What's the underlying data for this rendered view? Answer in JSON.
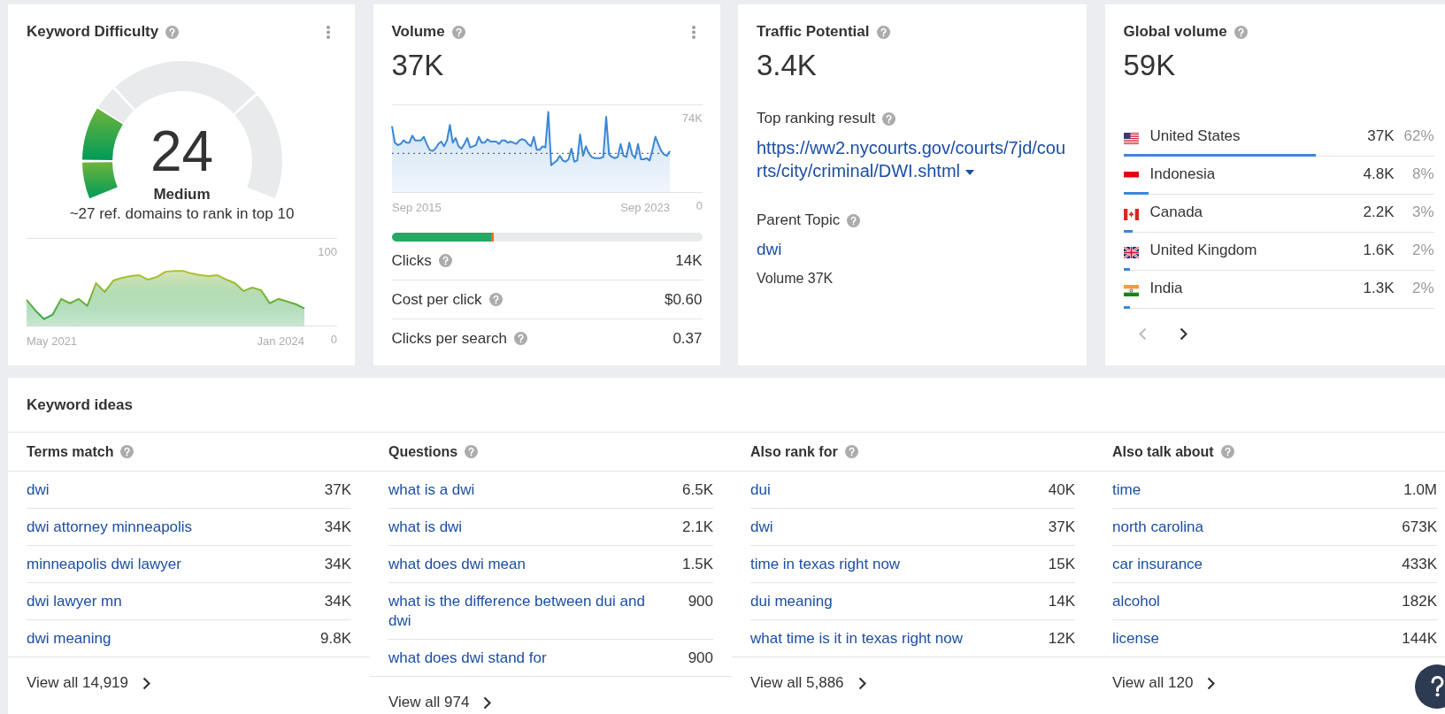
{
  "keyword_difficulty": {
    "title": "Keyword Difficulty",
    "score": "24",
    "level": 0.24,
    "rating": "Medium",
    "note": "~27 ref. domains to rank in top 10",
    "period_start": "May 2021",
    "period_end": "Jan 2024",
    "chart_data": {
      "type": "area",
      "series": [
        {
          "color": "#22a04b",
          "values": [
            30,
            18,
            8,
            13,
            31,
            26,
            31,
            23,
            49,
            39,
            52,
            55,
            57,
            58,
            53,
            56,
            62,
            63,
            63,
            60,
            58,
            57,
            58,
            53,
            49,
            40,
            44,
            41,
            26,
            31,
            28,
            25,
            20
          ]
        }
      ],
      "yticks": [
        0,
        100
      ],
      "ylim": [
        0,
        100
      ]
    }
  },
  "volume": {
    "title": "Volume",
    "value": "37K",
    "period_start": "Sep 2015",
    "period_end": "Sep 2023",
    "chart_data": {
      "type": "area",
      "series": [
        {
          "color": "#3a87d6",
          "values": [
            56,
            42,
            40,
            41,
            44,
            42,
            42,
            48,
            44,
            44,
            44,
            47,
            41,
            36,
            35,
            37,
            41,
            43,
            39,
            44,
            57,
            42,
            46,
            39,
            37,
            41,
            46,
            38,
            39,
            40,
            47,
            42,
            42,
            45,
            43,
            43,
            43,
            41,
            44,
            44,
            42,
            43,
            42,
            41,
            44,
            45,
            44,
            41,
            39,
            47,
            36,
            36,
            39,
            38,
            68,
            23,
            25,
            27,
            31,
            27,
            26,
            28,
            37,
            26,
            27,
            49,
            31,
            39,
            33,
            30,
            29,
            29,
            29,
            30,
            64,
            32,
            30,
            29,
            30,
            41,
            31,
            30,
            42,
            32,
            29,
            41,
            28,
            28,
            29,
            27,
            36,
            47,
            41,
            35,
            32,
            31,
            35
          ]
        }
      ],
      "yticks": [
        0,
        {
          "value": 74,
          "label": "74K"
        }
      ],
      "ylim": [
        0,
        74
      ],
      "ref_lines": [
        {
          "axis": "y",
          "value": 33
        }
      ]
    },
    "clicks_bar": {
      "segments": [
        {
          "color": "#27a864",
          "level": 0.32
        },
        {
          "color": "#f26b1d",
          "level": 0.01
        }
      ]
    },
    "metrics": [
      {
        "label": "Clicks",
        "value": "14K"
      },
      {
        "label": "Cost per click",
        "value": "$0.60"
      },
      {
        "label": "Clicks per search",
        "value": "0.37"
      }
    ]
  },
  "traffic_potential": {
    "title": "Traffic Potential",
    "value": "3.4K",
    "top_result": {
      "label": "Top ranking result",
      "url": "https://ww2.nycourts.gov/courts/7jd/courts/city/criminal/DWI.shtml"
    },
    "parent_topic": {
      "label": "Parent Topic",
      "keyword": "dwi",
      "volume": "Volume 37K"
    }
  },
  "global_volume": {
    "title": "Global volume",
    "value": "59K",
    "countries": [
      {
        "kind": "us",
        "name": "United States",
        "volume": "37K",
        "share": "62%",
        "level": 0.62
      },
      {
        "kind": "id",
        "name": "Indonesia",
        "volume": "4.8K",
        "share": "8%",
        "level": 0.08
      },
      {
        "kind": "ca",
        "name": "Canada",
        "volume": "2.2K",
        "share": "3%",
        "level": 0.03
      },
      {
        "kind": "gb",
        "name": "United Kingdom",
        "volume": "1.6K",
        "share": "2%",
        "level": 0.02
      },
      {
        "kind": "in",
        "name": "India",
        "volume": "1.3K",
        "share": "2%",
        "level": 0.02
      }
    ],
    "pager": [
      {
        "kind": "prev",
        "disabled": true
      },
      {
        "kind": "next",
        "disabled": false
      }
    ]
  },
  "keyword_ideas": {
    "title": "Keyword ideas",
    "columns": [
      {
        "title": "Terms match",
        "rows": [
          {
            "keyword": "dwi",
            "volume": "37K"
          },
          {
            "keyword": "dwi attorney minneapolis",
            "volume": "34K"
          },
          {
            "keyword": "minneapolis dwi lawyer",
            "volume": "34K"
          },
          {
            "keyword": "dwi lawyer mn",
            "volume": "34K"
          },
          {
            "keyword": "dwi meaning",
            "volume": "9.8K"
          }
        ],
        "view_all": "View all 14,919"
      },
      {
        "title": "Questions",
        "rows": [
          {
            "keyword": "what is a dwi",
            "volume": "6.5K"
          },
          {
            "keyword": "what is dwi",
            "volume": "2.1K"
          },
          {
            "keyword": "what does dwi mean",
            "volume": "1.5K"
          },
          {
            "keyword": "what is the difference between dui and dwi",
            "volume": "900"
          },
          {
            "keyword": "what does dwi stand for",
            "volume": "900"
          }
        ],
        "view_all": "View all 974"
      },
      {
        "title": "Also rank for",
        "rows": [
          {
            "keyword": "dui",
            "volume": "40K"
          },
          {
            "keyword": "dwi",
            "volume": "37K"
          },
          {
            "keyword": "time in texas right now",
            "volume": "15K"
          },
          {
            "keyword": "dui meaning",
            "volume": "14K"
          },
          {
            "keyword": "what time is it in texas right now",
            "volume": "12K"
          }
        ],
        "view_all": "View all 5,886"
      },
      {
        "title": "Also talk about",
        "rows": [
          {
            "keyword": "time",
            "volume": "1.0M"
          },
          {
            "keyword": "north carolina",
            "volume": "673K"
          },
          {
            "keyword": "car insurance",
            "volume": "433K"
          },
          {
            "keyword": "alcohol",
            "volume": "182K"
          },
          {
            "keyword": "license",
            "volume": "144K"
          }
        ],
        "view_all": "View all 120"
      }
    ]
  }
}
